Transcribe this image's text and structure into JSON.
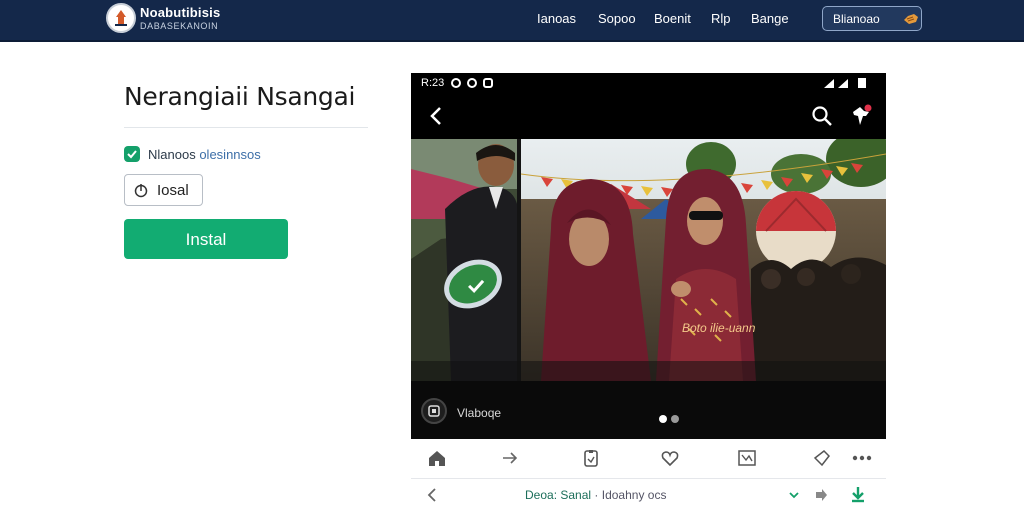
{
  "header": {
    "brand_title": "Noabutibisis",
    "brand_subtitle": "DABASEKANOIN",
    "nav": [
      "Ianoas",
      "Sopoo",
      "Boenit",
      "Rlp",
      "Bange"
    ],
    "pill_label": "Blianoao"
  },
  "app": {
    "title": "Nerangiaii Nsangai",
    "verified_label": "Nlanoos",
    "verified_accent": "olesinnsos",
    "secondary_button": "Iosal",
    "install_button": "Instal"
  },
  "phone": {
    "status_time": "R:23",
    "photo_caption": "Boto ilie-uann",
    "media_label": "Vlaboqe",
    "address_text": "Deoa: Sanal",
    "address_extra": "Idoahny ocs"
  },
  "colors": {
    "header_bg": "#14284a",
    "install_green": "#12ac72",
    "verified_green": "#14a06a"
  }
}
